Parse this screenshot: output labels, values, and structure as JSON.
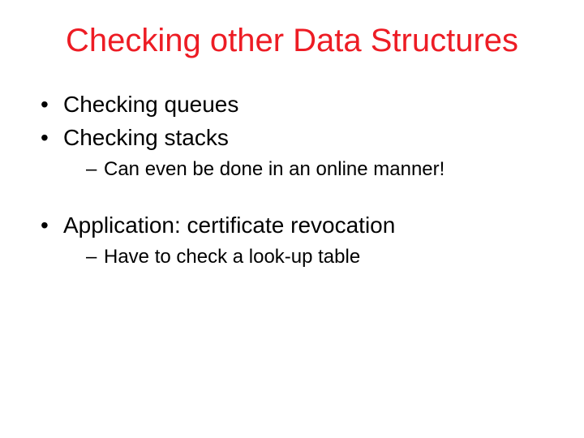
{
  "colors": {
    "title": "#ed1c24",
    "body": "#000000"
  },
  "title": "Checking other Data Structures",
  "bullets": {
    "b1": "Checking queues",
    "b2": "Checking stacks",
    "b2_sub1": "Can even be done in an online manner!",
    "b3": "Application: certificate revocation",
    "b3_sub1": "Have to check a look-up table"
  }
}
